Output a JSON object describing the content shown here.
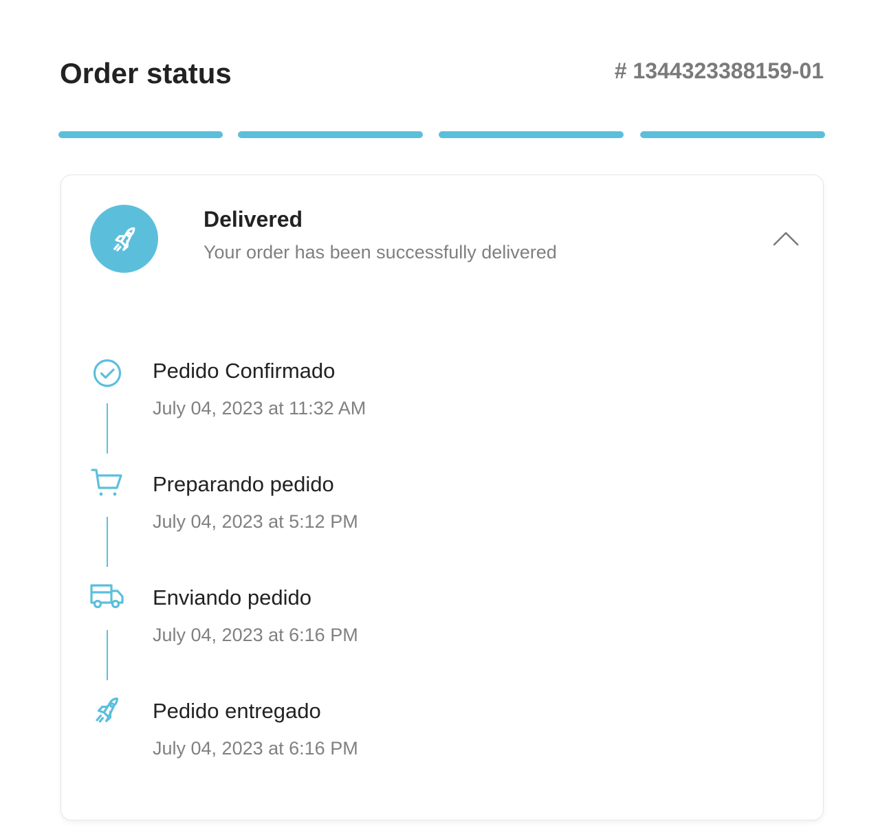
{
  "header": {
    "title": "Order status",
    "order_number": "# 1344323388159-01"
  },
  "progress": {
    "total_steps": 4,
    "completed_steps": 4
  },
  "status": {
    "title": "Delivered",
    "subtitle": "Your order has been successfully delivered",
    "icon": "rocket-icon",
    "expanded": true
  },
  "timeline": {
    "steps": [
      {
        "label": "Pedido Confirmado",
        "time": "July 04, 2023 at 11:32 AM",
        "icon": "check-circle-icon"
      },
      {
        "label": "Preparando pedido",
        "time": "July 04, 2023 at 5:12 PM",
        "icon": "cart-icon"
      },
      {
        "label": "Enviando pedido",
        "time": "July 04, 2023 at 6:16 PM",
        "icon": "truck-icon"
      },
      {
        "label": "Pedido entregado",
        "time": "July 04, 2023 at 6:16 PM",
        "icon": "rocket-icon"
      }
    ]
  },
  "colors": {
    "accent": "#5bbfdc",
    "title_text": "#222222",
    "muted_text": "#7f7f7f"
  }
}
